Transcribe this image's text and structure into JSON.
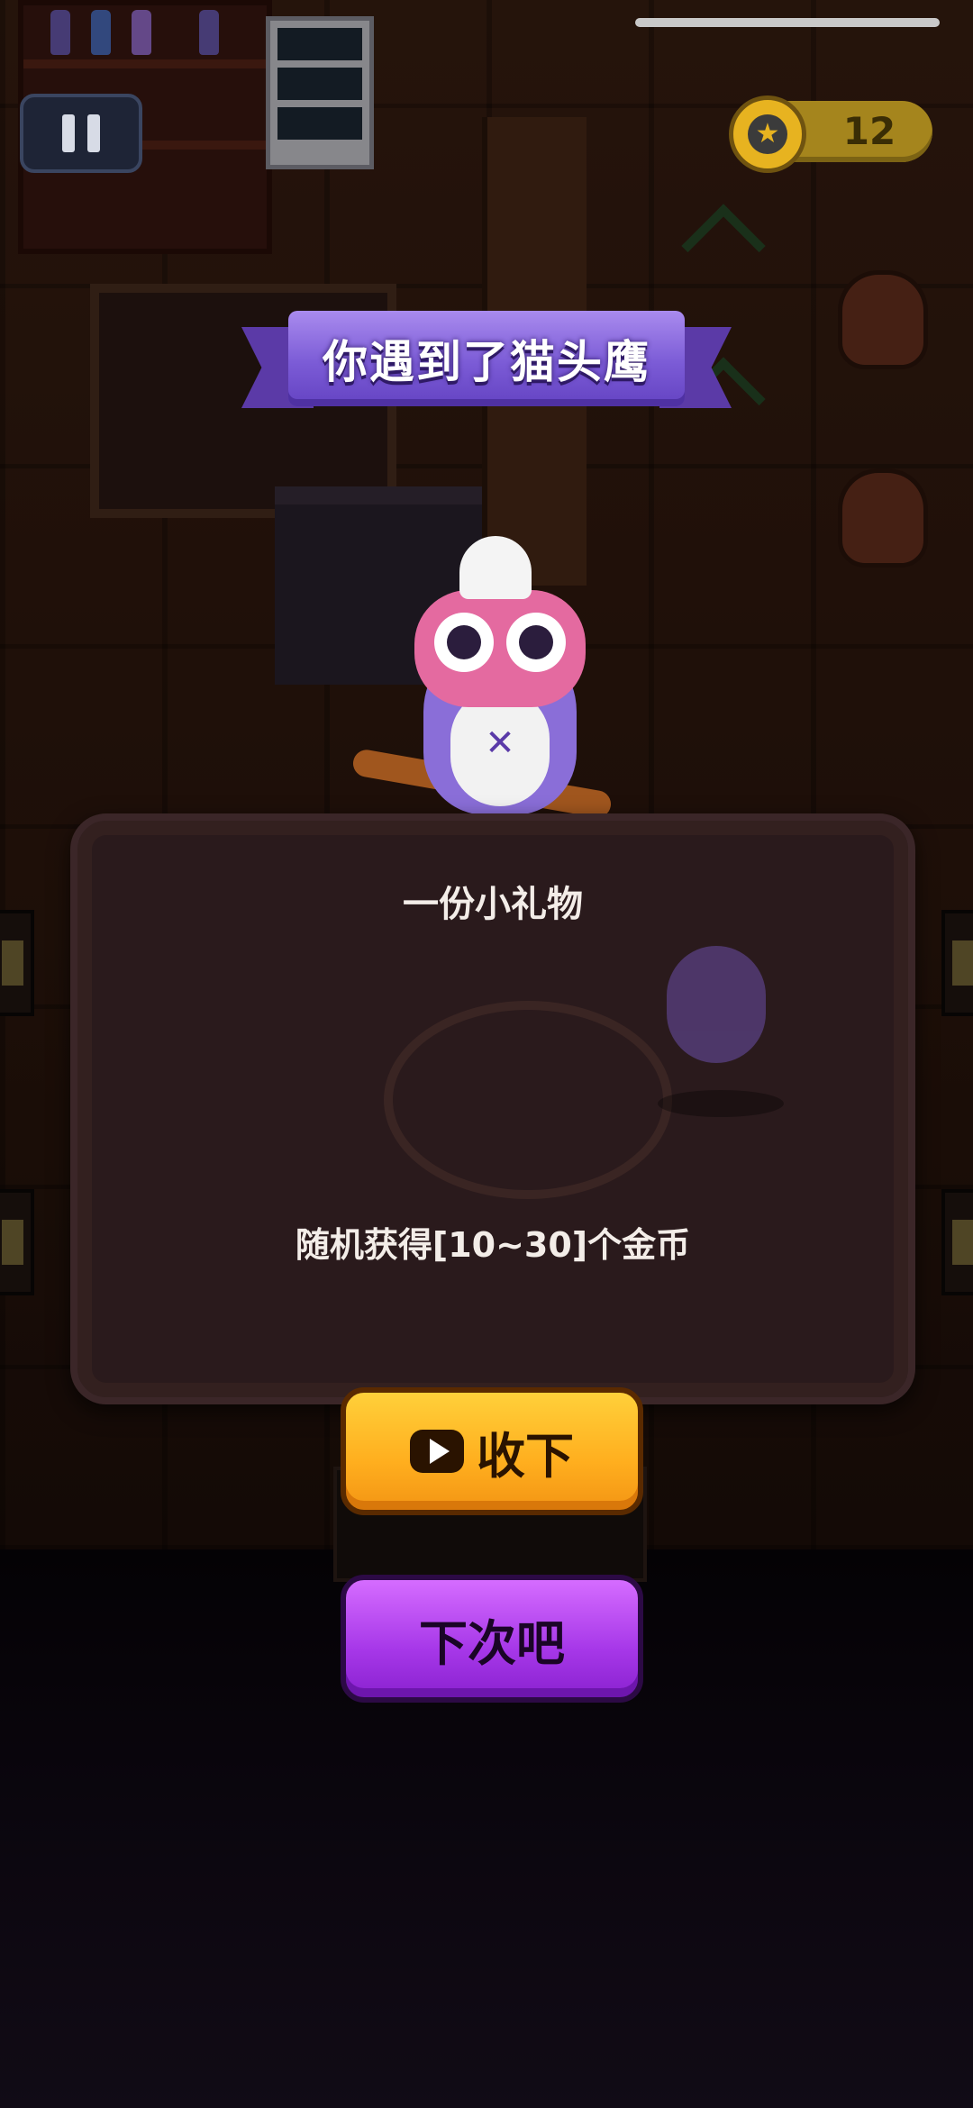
{
  "hud": {
    "pause_icon": "pause-icon",
    "coin_icon": "star-coin-icon",
    "coins": "12"
  },
  "dialog": {
    "title": "你遇到了猫头鹰",
    "gift_title": "一份小礼物",
    "reward_text": "随机获得[10~30]个金币",
    "accept_label": "收下",
    "accept_icon": "video-play-icon",
    "decline_label": "下次吧"
  },
  "colors": {
    "ribbon": "#7b5bd6",
    "accept_button": "#ffae1e",
    "decline_button": "#a637e8",
    "coin_bar": "#a5851d"
  }
}
